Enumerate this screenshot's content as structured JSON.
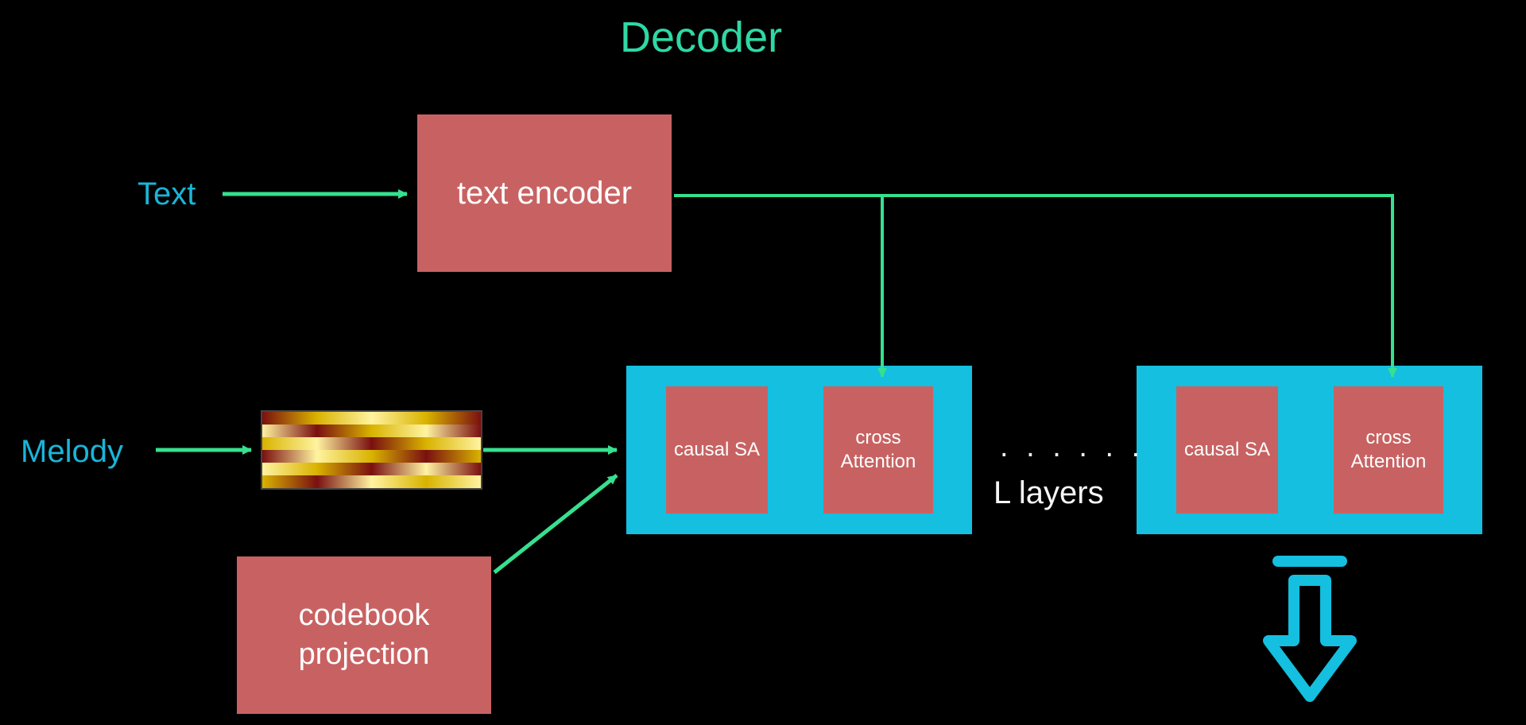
{
  "title": "Decoder",
  "inputs": {
    "text": "Text",
    "melody": "Melody"
  },
  "blocks": {
    "text_encoder": "text\nencoder",
    "codebook_projection": "codebook\nprojection",
    "causal_sa": "causal\nSA",
    "cross_attention": "cross\nAttention"
  },
  "layers_note": {
    "dots": ". . . . . .",
    "label": "L layers"
  },
  "colors": {
    "accent_green": "#2fd8a4",
    "accent_cyan": "#19b5d8",
    "block_red": "#c86262",
    "block_cyan": "#14bfe0",
    "arrow_green": "#36e08f",
    "arrow_cyan": "#14bfe0"
  }
}
